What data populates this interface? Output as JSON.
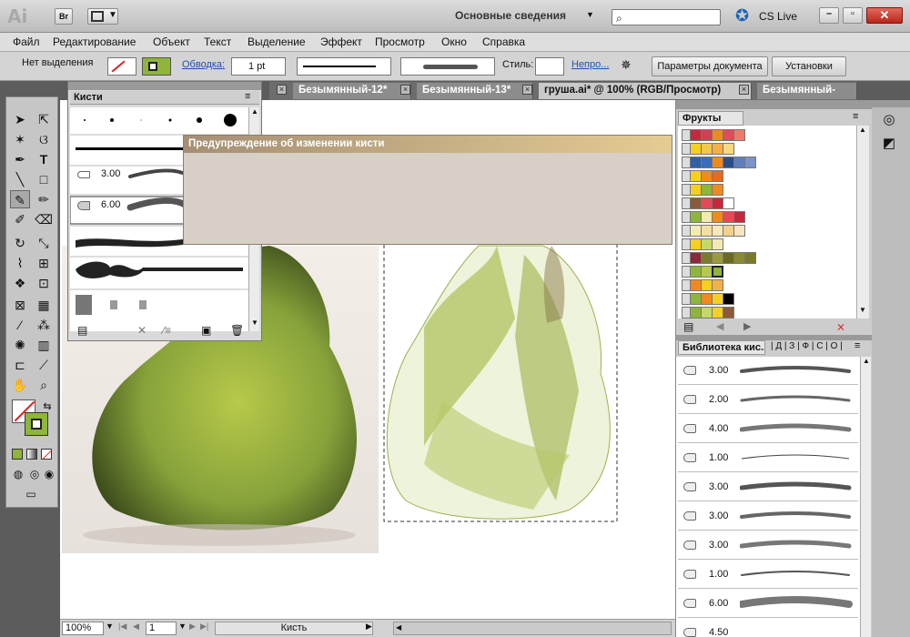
{
  "app": {
    "logo": "Ai",
    "bridge": "Br",
    "workspace": "Основные сведения",
    "cs_live": "CS Live"
  },
  "menu": [
    "Файл",
    "Редактирование",
    "Объект",
    "Текст",
    "Выделение",
    "Эффект",
    "Просмотр",
    "Окно",
    "Справка"
  ],
  "control": {
    "selection": "Нет выделения",
    "stroke_label": "Обводка:",
    "stroke_value": "1 pt",
    "style_label": "Стиль:",
    "opacity_label": "Непро...",
    "doc_settings": "Параметры документа",
    "preferences": "Установки"
  },
  "tabs": [
    {
      "label": "Безымянный-12*"
    },
    {
      "label": "Безымянный-13*"
    },
    {
      "label": "груша.ai* @ 100% (RGB/Просмотр)"
    },
    {
      "label": "Безымянный-"
    }
  ],
  "brush_panel": {
    "title": "Кисти",
    "rows": [
      "3.00",
      "6.00"
    ]
  },
  "dialog": {
    "title": "Предупреждение об изменении кисти"
  },
  "swatches": {
    "title": "Фрукты",
    "colors": {
      "red": "#c8283c",
      "pink": "#e24a5a",
      "orange": "#f08a1e",
      "yellow": "#f5d020",
      "green": "#8fb53a",
      "olive": "#7b7b2a",
      "blue": "#2f5fa8",
      "cream": "#f3e9b4",
      "black": "#000000",
      "white": "#ffffff",
      "brown": "#8b5a3c",
      "lightgreen": "#c7d86a"
    }
  },
  "library": {
    "title": "Библиотека кис...",
    "items": [
      "3.00",
      "2.00",
      "4.00",
      "1.00",
      "3.00",
      "3.00",
      "3.00",
      "1.00",
      "6.00",
      "4.50"
    ]
  },
  "status": {
    "zoom": "100%",
    "page": "1",
    "tool": "Кисть"
  }
}
